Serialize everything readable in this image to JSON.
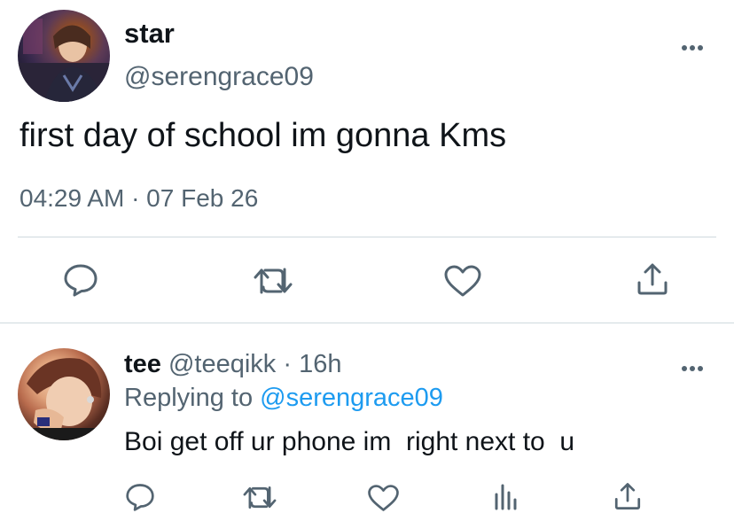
{
  "tweet": {
    "display_name": "star",
    "handle": "@serengrace09",
    "text": "first day of school im gonna Kms",
    "timestamp": "04:29 AM · 07 Feb 26",
    "more_icon": "more-horizontal-icon",
    "actions": [
      "reply-icon",
      "retweet-icon",
      "like-icon",
      "share-icon"
    ]
  },
  "reply": {
    "display_name": "tee",
    "handle": "@teeqikk",
    "separator": "·",
    "time": "16h",
    "replying_prefix": "Replying to",
    "replying_to": "@serengrace09",
    "text": "Boi get off ur phone im  right next to  u",
    "more_icon": "more-horizontal-icon",
    "actions": [
      "reply-icon",
      "retweet-icon",
      "like-icon",
      "analytics-icon",
      "share-icon"
    ]
  },
  "colors": {
    "text": "#0f1419",
    "secondary": "#536471",
    "link": "#1d9bf0",
    "divider": "#cfd9de"
  }
}
